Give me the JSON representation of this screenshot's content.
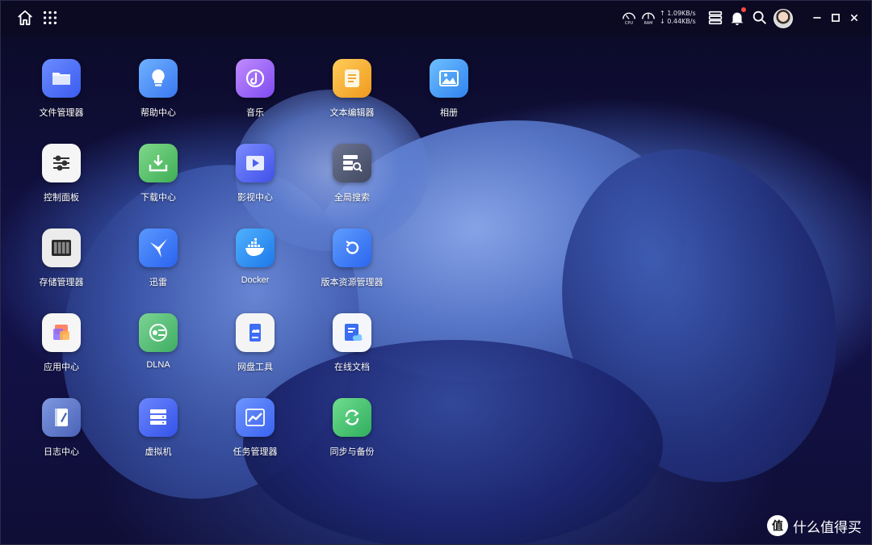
{
  "titlebar": {
    "home_icon": "home-icon",
    "apps_icon": "grid-icon",
    "cpu_label": "CPU",
    "ram_label": "RAM",
    "upload_speed": "↑ 1.09KB/s",
    "download_speed": "↓ 0.44KB/s",
    "task_icon": "list-icon",
    "notification_icon": "bell-icon",
    "search_icon": "search-icon",
    "minimize_icon": "minimize-icon",
    "maximize_icon": "maximize-icon",
    "close_icon": "close-icon"
  },
  "apps": [
    {
      "label": "文件管理器",
      "icon": "folder-icon",
      "bg": "#4a6cf7"
    },
    {
      "label": "帮助中心",
      "icon": "lightbulb-icon",
      "bg": "#4b8cf5"
    },
    {
      "label": "音乐",
      "icon": "music-icon",
      "bg": "#a266f0"
    },
    {
      "label": "文本编辑器",
      "icon": "notepad-icon",
      "bg": "#f2b233"
    },
    {
      "label": "相册",
      "icon": "photo-icon",
      "bg": "#4a9cf3"
    },
    {
      "label": "控制面板",
      "icon": "sliders-icon",
      "bg": "#f3f3f3"
    },
    {
      "label": "下载中心",
      "icon": "download-icon",
      "bg": "#5fc46a"
    },
    {
      "label": "影视中心",
      "icon": "video-icon",
      "bg": "#5b6df5"
    },
    {
      "label": "全局搜索",
      "icon": "search-panel-icon",
      "bg": "#5a6278"
    },
    {
      "label": "存储管理器",
      "icon": "storage-icon",
      "bg": "#eaeaea"
    },
    {
      "label": "迅雷",
      "icon": "thunder-bird-icon",
      "bg": "#3b7af5"
    },
    {
      "label": "Docker",
      "icon": "docker-icon",
      "bg": "#2a8ff0"
    },
    {
      "label": "版本资源管理器",
      "icon": "version-restore-icon",
      "bg": "#3b79f2"
    },
    {
      "label": "应用中心",
      "icon": "app-center-icon",
      "bg": "#f6f6f6"
    },
    {
      "label": "DLNA",
      "icon": "dlna-icon",
      "bg": "#58c07a"
    },
    {
      "label": "网盘工具",
      "icon": "cloud-drive-icon",
      "bg": "#f4f4f4"
    },
    {
      "label": "在线文档",
      "icon": "online-doc-icon",
      "bg": "#f4f6fb"
    },
    {
      "label": "日志中心",
      "icon": "log-icon",
      "bg": "#5d79c9"
    },
    {
      "label": "虚拟机",
      "icon": "server-icon",
      "bg": "#4e6ff2"
    },
    {
      "label": "任务管理器",
      "icon": "task-chart-icon",
      "bg": "#5077f2"
    },
    {
      "label": "同步与备份",
      "icon": "sync-icon",
      "bg": "#45c477"
    }
  ],
  "watermark": {
    "logo_text": "值",
    "text": "什么值得买"
  }
}
